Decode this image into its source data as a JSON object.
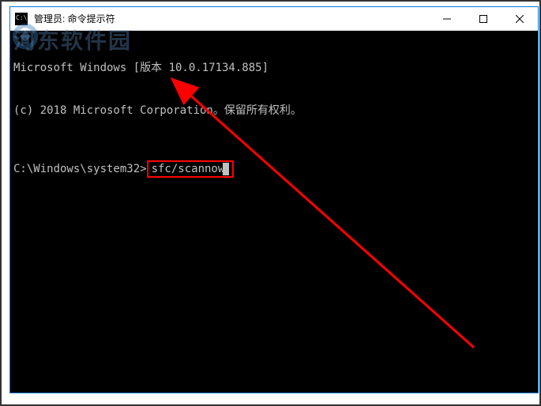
{
  "window": {
    "title": "管理员: 命令提示符"
  },
  "terminal": {
    "line1": "Microsoft Windows [版本 10.0.17134.885]",
    "line2": "(c) 2018 Microsoft Corporation。保留所有权利。",
    "prompt": "C:\\Windows\\system32>",
    "command": "sfc/scannow"
  },
  "watermark": {
    "text": "河东软件园"
  },
  "annotation": {
    "box_color": "#ff0000",
    "arrow_color": "#ff0000"
  }
}
